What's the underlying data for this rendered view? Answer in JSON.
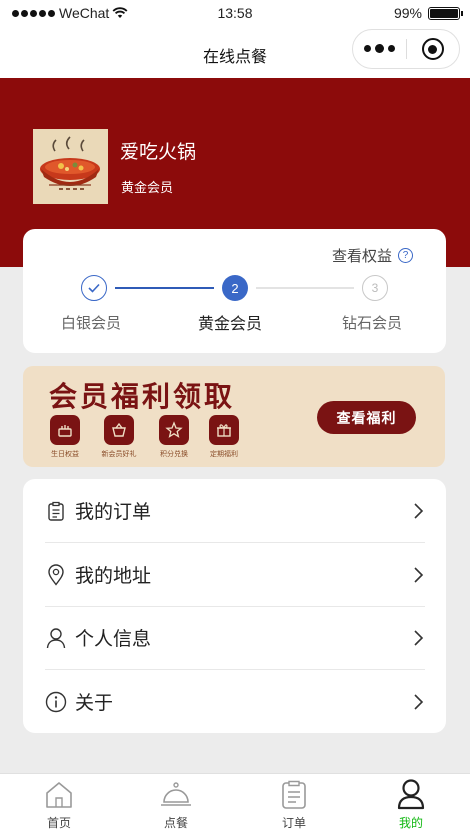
{
  "status_bar": {
    "carrier": "WeChat",
    "time": "13:58",
    "battery": "99%"
  },
  "nav": {
    "title": "在线点餐"
  },
  "profile": {
    "name": "爱吃火锅",
    "level": "黄金会员"
  },
  "levels": {
    "view_benefits": "查看权益",
    "current_step": "2",
    "steps": [
      {
        "label": "白银会员",
        "status": "done"
      },
      {
        "label": "黄金会员",
        "status": "current",
        "number": "2"
      },
      {
        "label": "钻石会员",
        "status": "todo",
        "number": "3"
      }
    ]
  },
  "banner": {
    "title": "会员福利领取",
    "button": "查看福利",
    "perks": [
      {
        "label": "生日权益",
        "icon": "cake-icon"
      },
      {
        "label": "新会员好礼",
        "icon": "basket-icon"
      },
      {
        "label": "积分兑换",
        "icon": "star-icon"
      },
      {
        "label": "定期福利",
        "icon": "gift-icon"
      }
    ]
  },
  "menu": [
    {
      "label": "我的订单",
      "icon": "order-list-icon"
    },
    {
      "label": "我的地址",
      "icon": "location-icon"
    },
    {
      "label": "个人信息",
      "icon": "user-icon"
    },
    {
      "label": "关于",
      "icon": "info-icon"
    }
  ],
  "tabs": [
    {
      "label": "首页",
      "icon": "home-icon"
    },
    {
      "label": "点餐",
      "icon": "dining-bell-icon"
    },
    {
      "label": "订单",
      "icon": "order-icon"
    },
    {
      "label": "我的",
      "icon": "profile-icon",
      "active": true
    }
  ],
  "colors": {
    "brand_red": "#8c0b0b",
    "step_blue": "#3a68c7",
    "active_tab": "#11b811",
    "banner_bg": "#f0dfc6"
  }
}
